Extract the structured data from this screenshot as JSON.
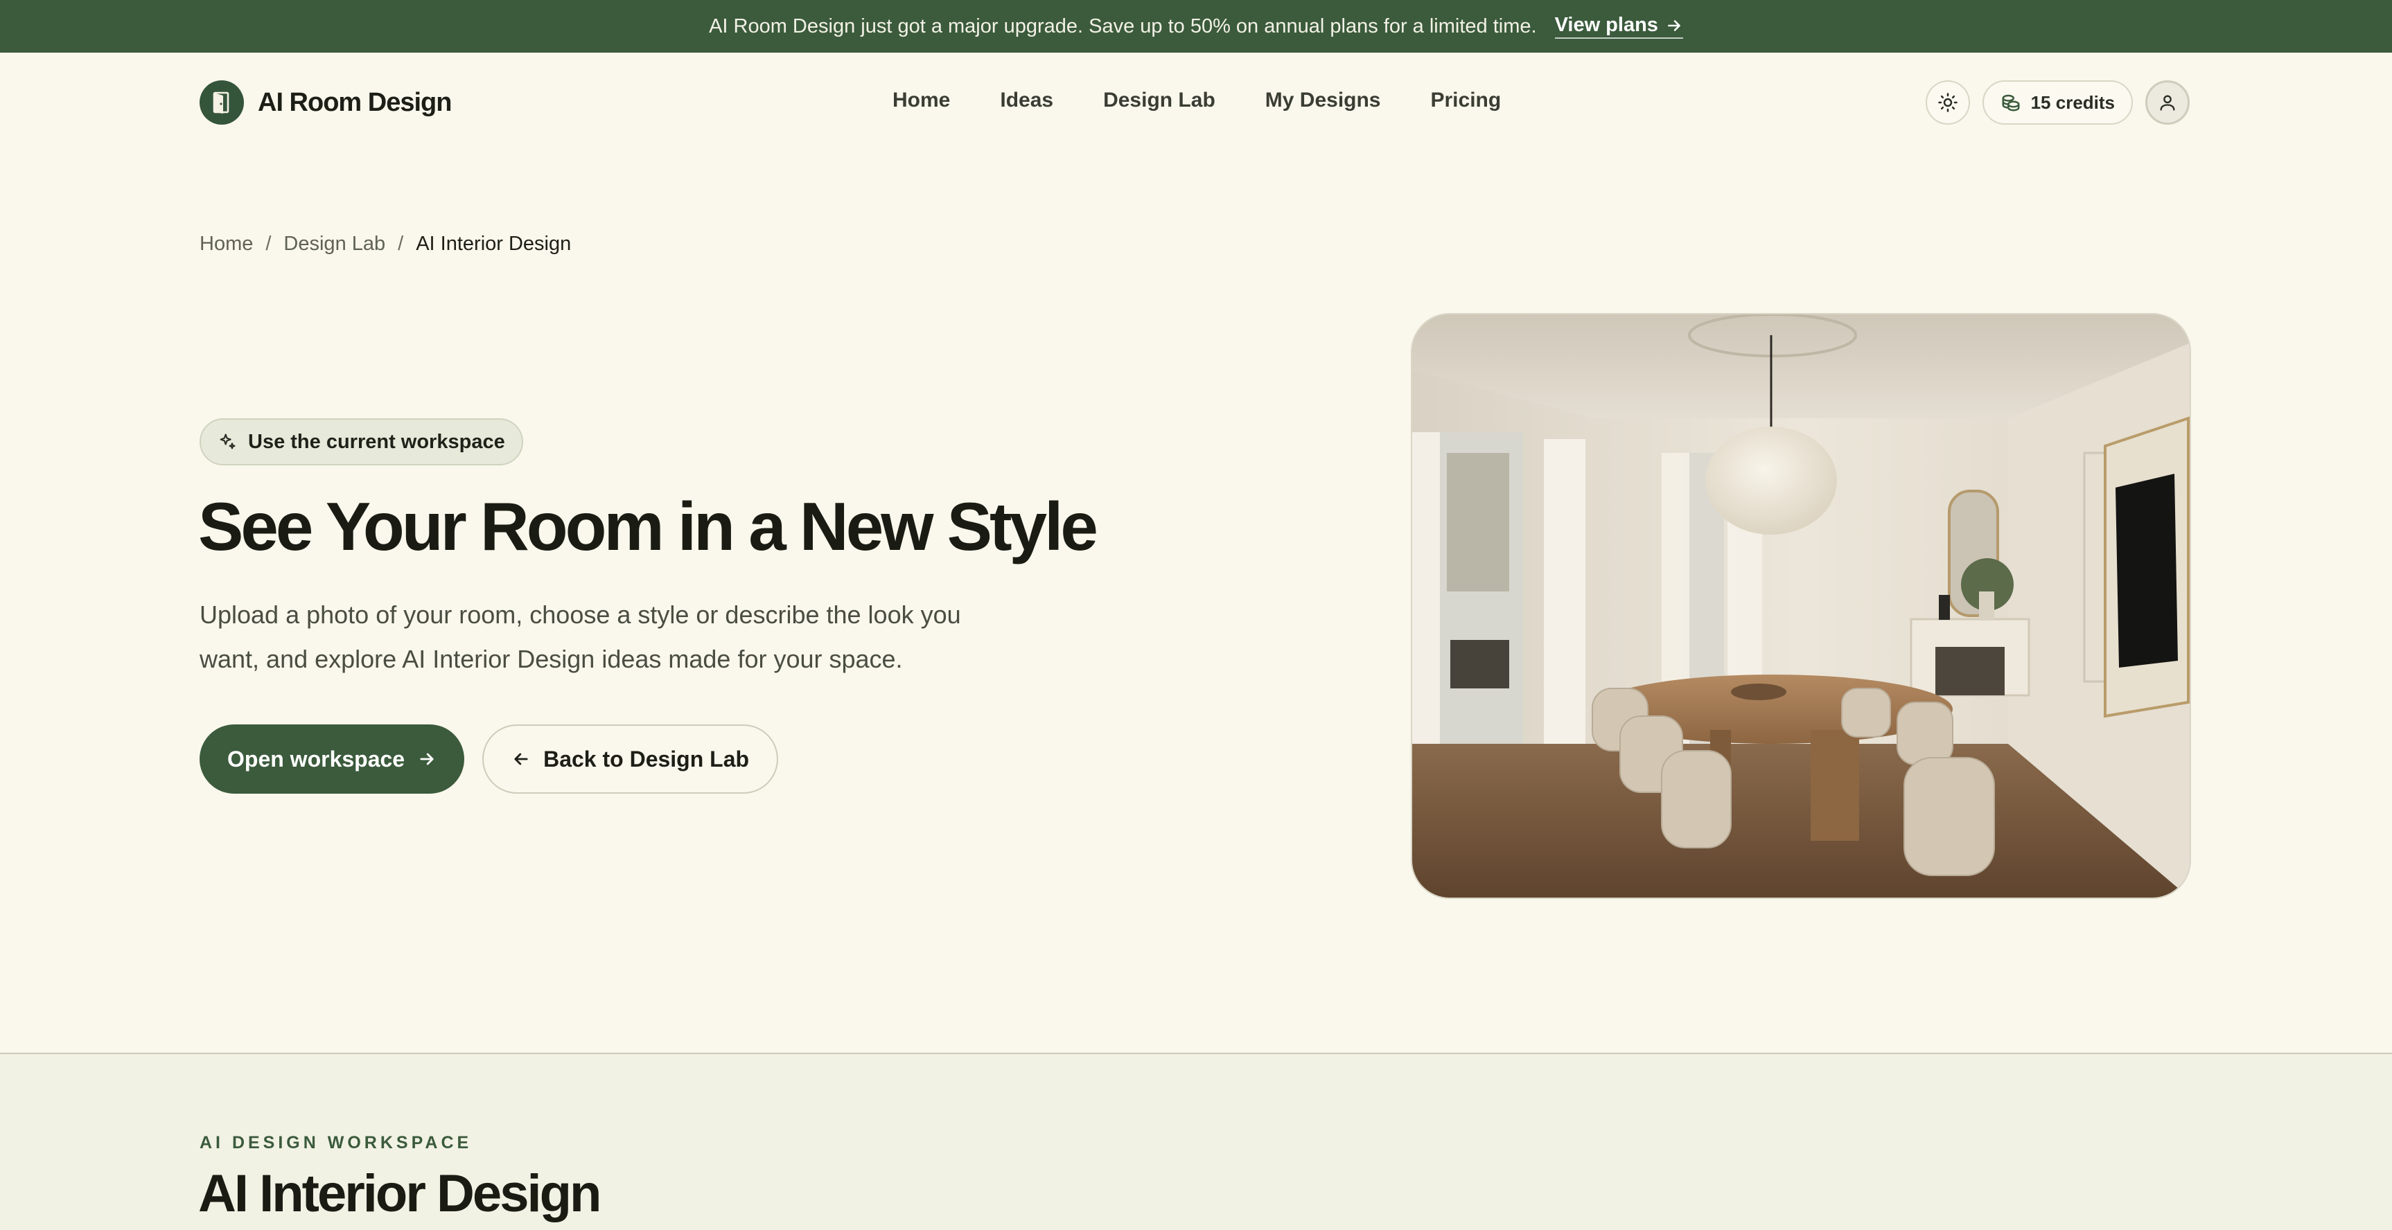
{
  "announcement": {
    "text": "AI Room Design just got a major upgrade. Save up to 50% on annual plans for a limited time.",
    "link_label": "View plans"
  },
  "brand": {
    "name": "AI Room Design"
  },
  "nav": {
    "items": [
      "Home",
      "Ideas",
      "Design Lab",
      "My Designs",
      "Pricing"
    ]
  },
  "header": {
    "credits_label": "15 credits"
  },
  "breadcrumb": {
    "items": [
      "Home",
      "Design Lab",
      "AI Interior Design"
    ],
    "separator": "/"
  },
  "hero": {
    "pill_label": "Use the current workspace",
    "title": "See Your Room in a New Style",
    "description": "Upload a photo of your room, choose a style or describe the look you want, and explore AI Interior Design ideas made for your space.",
    "primary_button": "Open workspace",
    "secondary_button": "Back to Design Lab"
  },
  "section": {
    "eyebrow": "AI DESIGN WORKSPACE",
    "title": "AI Interior Design"
  },
  "colors": {
    "brand_green": "#3b5b3c",
    "page_background": "#faf7ec",
    "lower_background": "#f1f2e4"
  }
}
